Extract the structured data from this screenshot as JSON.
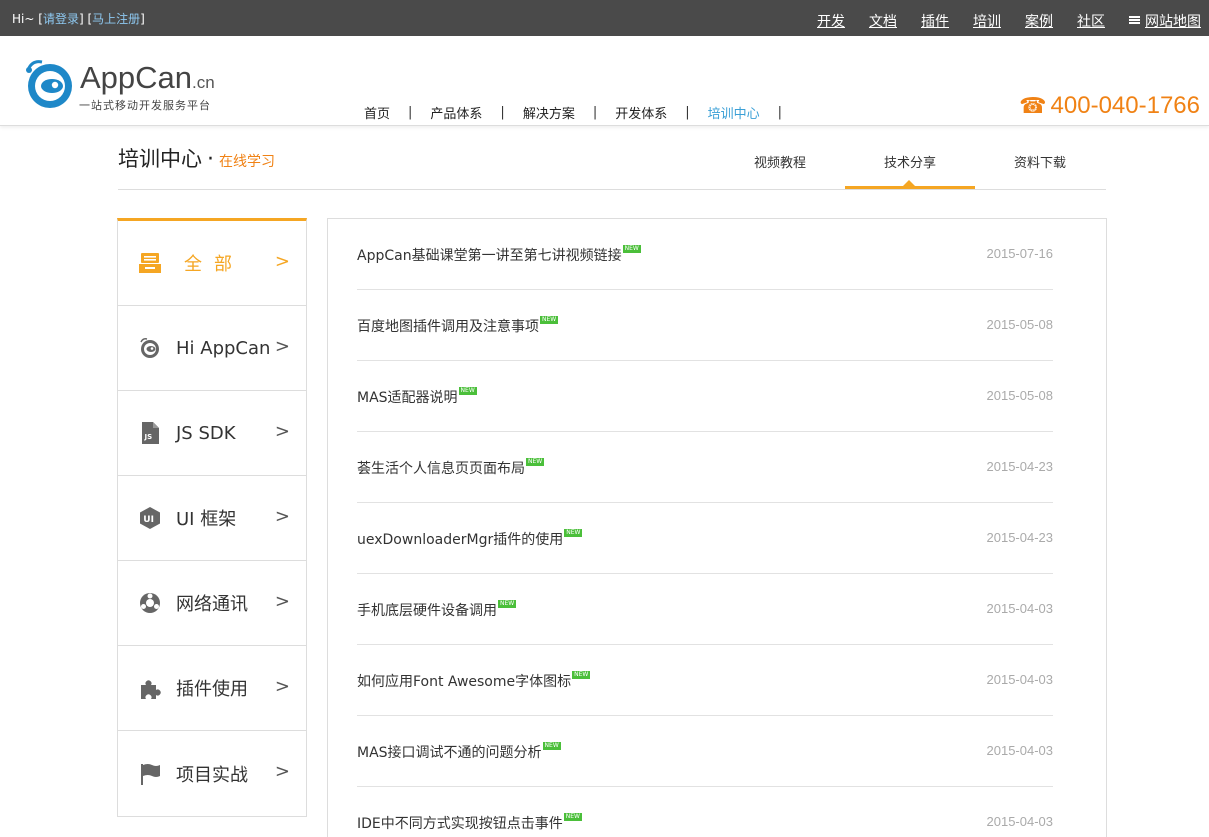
{
  "topbar": {
    "greeting": "Hi~",
    "login": "请登录",
    "register": "马上注册",
    "bracket_open": "[",
    "bracket_close": "]",
    "nav": [
      "开发",
      "文档",
      "插件",
      "培训",
      "案例",
      "社区"
    ],
    "sitemap": "网站地图"
  },
  "header": {
    "brand": "AppCan",
    "brand_suffix": ".cn",
    "tagline": "一站式移动开发服务平台",
    "nav": [
      {
        "label": "首页",
        "active": false
      },
      {
        "label": "产品体系",
        "active": false
      },
      {
        "label": "解决方案",
        "active": false
      },
      {
        "label": "开发体系",
        "active": false
      },
      {
        "label": "培训中心",
        "active": true
      }
    ],
    "separator": "|",
    "phone": "400-040-1766"
  },
  "page": {
    "title": "培训中心",
    "dot": "·",
    "subtitle": "在线学习",
    "tabs": [
      {
        "label": "视频教程",
        "active": false
      },
      {
        "label": "技术分享",
        "active": true
      },
      {
        "label": "资料下载",
        "active": false
      }
    ]
  },
  "sidebar": {
    "items": [
      {
        "label": "全部",
        "icon": "box-icon",
        "active": true
      },
      {
        "label": "Hi AppCan",
        "icon": "appcan-icon",
        "active": false
      },
      {
        "label": "JS SDK",
        "icon": "js-file-icon",
        "active": false
      },
      {
        "label": "UI 框架",
        "icon": "ui-hexagon-icon",
        "active": false
      },
      {
        "label": "网络通讯",
        "icon": "network-icon",
        "active": false
      },
      {
        "label": "插件使用",
        "icon": "puzzle-icon",
        "active": false
      },
      {
        "label": "项目实战",
        "icon": "flag-icon",
        "active": false
      }
    ],
    "arrow": ">"
  },
  "articles": {
    "new_badge": "NEW",
    "items": [
      {
        "title": "AppCan基础课堂第一讲至第七讲视频链接",
        "date": "2015-07-16"
      },
      {
        "title": "百度地图插件调用及注意事项",
        "date": "2015-05-08"
      },
      {
        "title": "MAS适配器说明",
        "date": "2015-05-08"
      },
      {
        "title": "荟生活个人信息页页面布局",
        "date": "2015-04-23"
      },
      {
        "title": "uexDownloaderMgr插件的使用",
        "date": "2015-04-23"
      },
      {
        "title": "手机底层硬件设备调用",
        "date": "2015-04-03"
      },
      {
        "title": "如何应用Font Awesome字体图标",
        "date": "2015-04-03"
      },
      {
        "title": "MAS接口调试不通的问题分析",
        "date": "2015-04-03"
      },
      {
        "title": "IDE中不同方式实现按钮点击事件",
        "date": "2015-04-03"
      }
    ]
  },
  "colors": {
    "accent": "#f5a623",
    "phone": "#f08215",
    "link": "#3a9fd6",
    "topbar": "#4a4a4a",
    "new_badge": "#4bbf3a"
  }
}
